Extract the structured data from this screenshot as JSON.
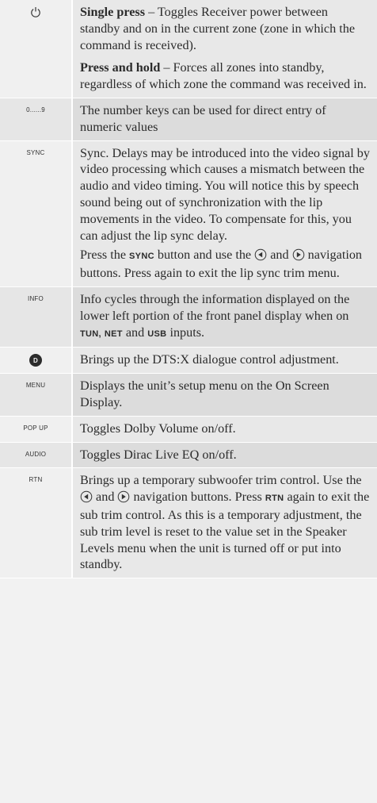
{
  "rows": [
    {
      "key": "",
      "key_icon": "power-icon",
      "p1_bold": "Single press",
      "p1_text": " – Toggles Receiver power between standby and on in the current zone (zone in which the command is received).",
      "p2_bold": "Press and hold",
      "p2_text": " – Forces all zones into standby, regardless of which zone the command was received in."
    },
    {
      "key": "0......9",
      "text": "The number keys can be used for direct entry of numeric values"
    },
    {
      "key": "SYNC",
      "p1_text": "Sync. Delays may be introduced into the video signal by video processing which causes a mismatch between the audio and video timing. You will notice this by speech sound being out of synchronization with the lip movements in the video. To compensate for this, you can adjust the lip sync delay.",
      "p2_a": "Press the ",
      "p2_btn": "SYNC",
      "p2_b": " button and use the ",
      "p2_and": " and ",
      "p2_c": " navigation buttons. Press again to exit the lip sync trim menu."
    },
    {
      "key": "INFO",
      "text_a": "Info cycles through the information displayed on the lower left portion of the front panel display when on ",
      "btn1": "TUN,",
      "btn2": "NET",
      "and": " and ",
      "btn3": "USB",
      "text_b": " inputs."
    },
    {
      "key": "",
      "key_icon": "dts-dialogue-icon",
      "text": "Brings up the DTS:X dialogue control adjustment."
    },
    {
      "key": "MENU",
      "text": "Displays the unit’s setup menu on the On Screen Display."
    },
    {
      "key": "POP UP",
      "text": "Toggles Dolby Volume on/off."
    },
    {
      "key": "AUDIO",
      "text": "Toggles Dirac Live EQ on/off."
    },
    {
      "key": "RTN",
      "text_a": "Brings up a temporary subwoofer trim control. Use the ",
      "and": " and ",
      "text_b": " navigation buttons. Press ",
      "btn": "RTN",
      "text_c": " again to exit the sub trim control. As this is a temporary adjustment, the sub trim level is reset to the value set in the Speaker Levels menu when the unit is turned off or put into standby."
    }
  ]
}
